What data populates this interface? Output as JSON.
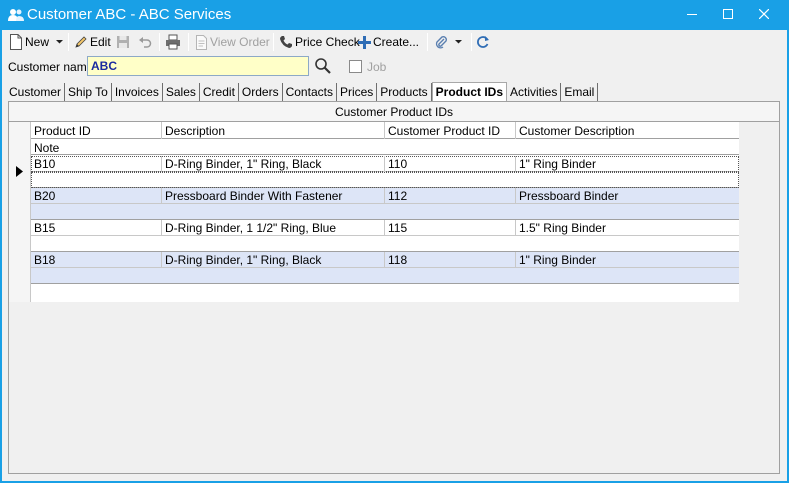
{
  "window": {
    "title": "Customer ABC - ABC Services"
  },
  "toolbar": {
    "new_label": "New",
    "edit_label": "Edit",
    "view_order_label": "View Order",
    "price_check_label": "Price Check",
    "create_label": "Create..."
  },
  "customer": {
    "label": "Customer name",
    "value": "ABC",
    "job_label": "Job"
  },
  "tabs": [
    {
      "label": "Customer"
    },
    {
      "label": "Ship To"
    },
    {
      "label": "Invoices"
    },
    {
      "label": "Sales"
    },
    {
      "label": "Credit"
    },
    {
      "label": "Orders"
    },
    {
      "label": "Contacts"
    },
    {
      "label": "Prices"
    },
    {
      "label": "Products"
    },
    {
      "label": "Product IDs"
    },
    {
      "label": "Activities"
    },
    {
      "label": "Email"
    }
  ],
  "active_tab": "Product IDs",
  "grid": {
    "caption": "Customer Product IDs",
    "columns": {
      "product_id": "Product ID",
      "description": "Description",
      "customer_product_id": "Customer Product ID",
      "customer_description": "Customer Description",
      "note": "Note"
    },
    "rows": [
      {
        "product_id": "B10",
        "description": "D-Ring Binder, 1\" Ring, Black",
        "customer_product_id": "110",
        "customer_description": "1\" Ring Binder",
        "note": ""
      },
      {
        "product_id": "B20",
        "description": "Pressboard Binder With Fastener",
        "customer_product_id": "112",
        "customer_description": "Pressboard Binder",
        "note": ""
      },
      {
        "product_id": "B15",
        "description": "D-Ring Binder, 1 1/2\" Ring, Blue",
        "customer_product_id": "115",
        "customer_description": "1.5\" Ring Binder",
        "note": ""
      },
      {
        "product_id": "B18",
        "description": "D-Ring Binder, 1\" Ring, Black",
        "customer_product_id": "118",
        "customer_description": "1\" Ring Binder",
        "note": ""
      }
    ]
  },
  "colors": {
    "titlebar": "#19a0e6",
    "alt_row": "#dde5f7",
    "customer_input_bg": "#ffffc8"
  }
}
